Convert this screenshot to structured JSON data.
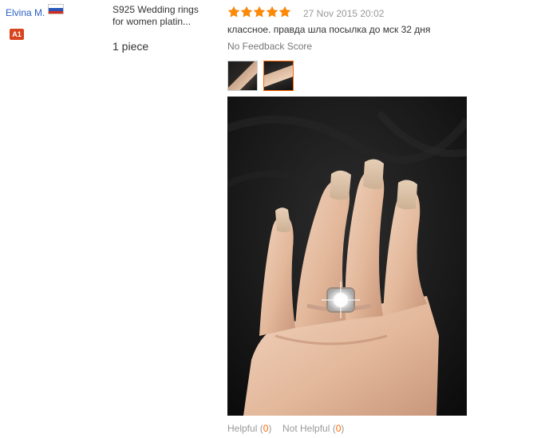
{
  "reviewer": {
    "name": "Elvina M.",
    "country_flag": "russia-flag-icon",
    "level_badge": "A1"
  },
  "product": {
    "name": "S925 Wedding rings for women platin...",
    "quantity": "1 piece"
  },
  "review": {
    "rating": 5,
    "rating_max": 5,
    "star_color": "#ff8a00",
    "date": "27 Nov 2015 20:02",
    "text": "классное. правда шла посылка до мск 32 дня",
    "feedback_score": "No Feedback Score"
  },
  "helpful": {
    "helpful_label": "Helpful",
    "helpful_count": "0",
    "not_helpful_label": "Not Helpful",
    "not_helpful_count": "0"
  },
  "colors": {
    "link": "#2b61c5",
    "accent": "#ff6600",
    "badge": "#d9441f"
  }
}
